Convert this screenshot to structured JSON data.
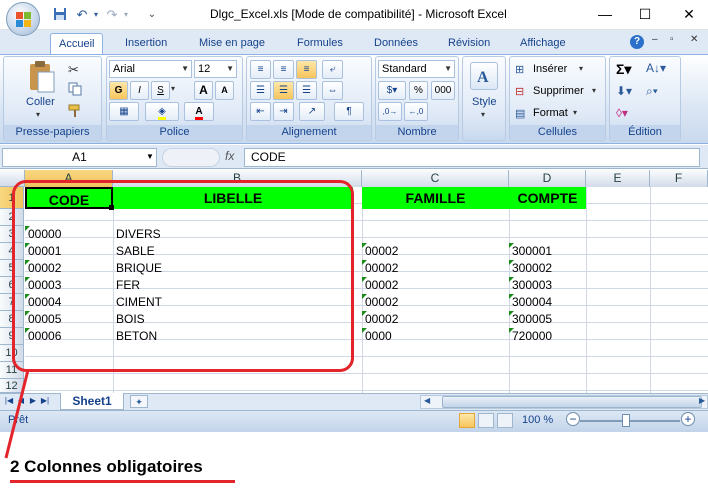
{
  "window": {
    "title": "Dlgc_Excel.xls  [Mode de compatibilité] - Microsoft Excel",
    "minimize_icon": "—",
    "maximize_icon": "☐",
    "close_icon": "✕"
  },
  "quick_access": {
    "save_icon": "save-icon",
    "undo_icon": "undo-icon",
    "redo_icon": "redo-icon"
  },
  "tabs": [
    "Accueil",
    "Insertion",
    "Mise en page",
    "Formules",
    "Données",
    "Révision",
    "Affichage"
  ],
  "ribbon": {
    "clipboard": {
      "label": "Presse-papiers",
      "paste": "Coller"
    },
    "font": {
      "label": "Police",
      "name": "Arial",
      "size": "12",
      "bold": "G",
      "italic": "I",
      "underline": "S",
      "grow": "A",
      "shrink": "A"
    },
    "alignment": {
      "label": "Alignement"
    },
    "number": {
      "label": "Nombre",
      "format": "Standard",
      "percent": "%",
      "thousands": "000"
    },
    "style": {
      "label": "Style"
    },
    "cells": {
      "label": "Cellules",
      "insert": "Insérer",
      "delete": "Supprimer",
      "format": "Format"
    },
    "editing": {
      "label": "Édition"
    }
  },
  "formula_bar": {
    "name_box": "A1",
    "fx": "fx",
    "formula": "CODE"
  },
  "columns": [
    "A",
    "B",
    "C",
    "D",
    "E",
    "F"
  ],
  "rows": [
    "1",
    "2",
    "3",
    "4",
    "5",
    "6",
    "7",
    "8",
    "9",
    "10",
    "11",
    "12"
  ],
  "headers": {
    "code": "CODE",
    "libelle": "LIBELLE",
    "famille": "FAMILLE",
    "compte": "COMPTE"
  },
  "table": [
    {
      "code": "00000",
      "libelle": "DIVERS",
      "famille": "",
      "compte": ""
    },
    {
      "code": "00001",
      "libelle": "SABLE",
      "famille": "00002",
      "compte": "300001"
    },
    {
      "code": "00002",
      "libelle": "BRIQUE",
      "famille": "00002",
      "compte": "300002"
    },
    {
      "code": "00003",
      "libelle": "FER",
      "famille": "00002",
      "compte": "300003"
    },
    {
      "code": "00004",
      "libelle": "CIMENT",
      "famille": "00002",
      "compte": "300004"
    },
    {
      "code": "00005",
      "libelle": "BOIS",
      "famille": "00002",
      "compte": "300005"
    },
    {
      "code": "00006",
      "libelle": "BETON",
      "famille": "0000",
      "compte": "720000"
    }
  ],
  "sheet": {
    "tab": "Sheet1"
  },
  "status": {
    "ready": "Prêt",
    "zoom": "100 %",
    "zoom_minus": "−",
    "zoom_plus": "+"
  },
  "annotation": {
    "caption": "2 Colonnes obligatoires",
    "color": "#e3242b"
  },
  "colors": {
    "header_fill": "#00ff00",
    "ribbon_text": "#15428b"
  }
}
